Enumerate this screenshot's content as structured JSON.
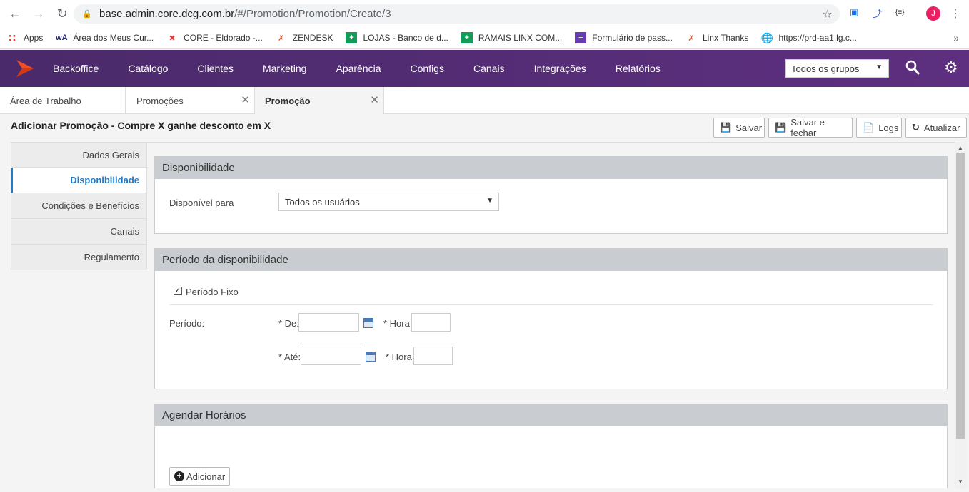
{
  "browser": {
    "url_host": "base.admin.core.dcg.com.br",
    "url_path": "/#/Promotion/Promotion/Create/3",
    "avatar_letter": "J",
    "bookmarks": [
      {
        "label": "Apps",
        "icon": "apps-grid-icon"
      },
      {
        "label": "Área dos Meus Cur...",
        "icon": "wa-icon"
      },
      {
        "label": "CORE - Eldorado -...",
        "icon": "core-icon"
      },
      {
        "label": "ZENDESK",
        "icon": "linx-icon"
      },
      {
        "label": "LOJAS - Banco de d...",
        "icon": "sheets-icon"
      },
      {
        "label": "RAMAIS LINX COM...",
        "icon": "sheets-icon"
      },
      {
        "label": "Formulário de pass...",
        "icon": "forms-icon"
      },
      {
        "label": "Linx Thanks",
        "icon": "linx-icon"
      },
      {
        "label": "https://prd-aa1.lg.c...",
        "icon": "globe-icon"
      }
    ]
  },
  "header": {
    "menu": [
      "Backoffice",
      "Catálogo",
      "Clientes",
      "Marketing",
      "Aparência",
      "Configs",
      "Canais",
      "Integrações",
      "Relatórios"
    ],
    "group_select": "Todos os grupos",
    "colors": {
      "primary": "#5c2d7c",
      "accent": "#1f7ac7",
      "logo": "#f04e23"
    }
  },
  "tabs": [
    {
      "label": "Área de Trabalho"
    },
    {
      "label": "Promoções"
    },
    {
      "label": "Promoção"
    }
  ],
  "page": {
    "title": "Adicionar Promoção - Compre X ganhe desconto em X",
    "buttons": {
      "save": "Salvar",
      "save_close": "Salvar e fechar",
      "logs": "Logs",
      "refresh": "Atualizar"
    }
  },
  "subnav": [
    "Dados Gerais",
    "Disponibilidade",
    "Condições e Benefícios",
    "Canais",
    "Regulamento"
  ],
  "availability": {
    "title": "Disponibilidade",
    "label": "Disponível para",
    "value": "Todos os usuários"
  },
  "period": {
    "title": "Período da disponibilidade",
    "fixed_label": "Período Fixo",
    "fixed_checked": true,
    "period_label": "Período:",
    "from_label": "* De:",
    "to_label": "* Até:",
    "hour_label": "* Hora:"
  },
  "schedule": {
    "title": "Agendar Horários",
    "add_label": "Adicionar"
  }
}
